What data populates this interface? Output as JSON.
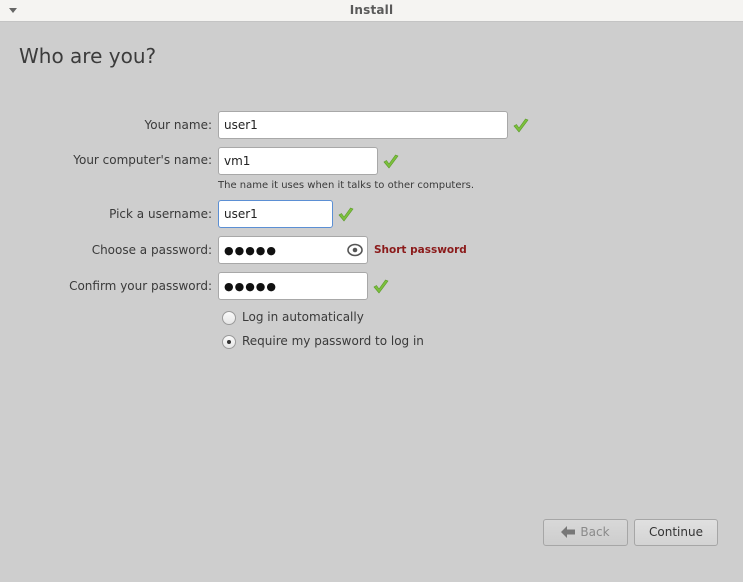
{
  "window": {
    "title": "Install"
  },
  "page": {
    "title": "Who are you?"
  },
  "form": {
    "name": {
      "label": "Your name:",
      "value": "user1",
      "valid": true
    },
    "computer_name": {
      "label": "Your computer's name:",
      "value": "vm1",
      "valid": true,
      "hint": "The name it uses when it talks to other computers."
    },
    "username": {
      "label": "Pick a username:",
      "value": "user1",
      "valid": true
    },
    "password": {
      "label": "Choose a password:",
      "masked_value": "●●●●●",
      "strength": "Short password"
    },
    "confirm_password": {
      "label": "Confirm your password:",
      "masked_value": "●●●●●",
      "valid": true
    },
    "login_options": [
      {
        "label": "Log in automatically",
        "selected": false
      },
      {
        "label": "Require my password to log in",
        "selected": true
      }
    ]
  },
  "buttons": {
    "back": "Back",
    "continue": "Continue"
  },
  "colors": {
    "valid_check": "#7cc03c",
    "error_text": "#8b1a1a",
    "focus_border": "#5b8fd4"
  }
}
